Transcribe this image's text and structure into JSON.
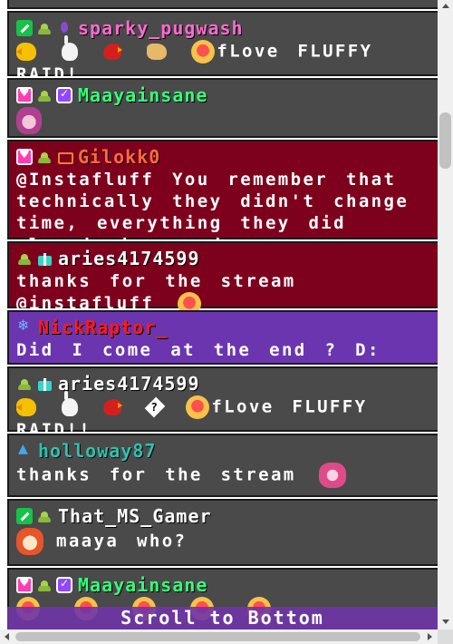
{
  "scroll_banner": "Scroll to Bottom",
  "messages": [
    {
      "user": "sparky_pugwash",
      "user_color": "#ff69d2",
      "badges": [
        "moderator-icon",
        "poo-badge-icon",
        "drop-badge-icon"
      ],
      "emotes": [
        "chick-emote-icon",
        "bunny-emote-icon",
        "bird-emote-icon",
        "dog-emote-icon",
        "fluff-emote-icon"
      ],
      "text": "fLove FLUFFY RAID!"
    },
    {
      "user": "Maayainsane",
      "user_color": "#33ff7a",
      "badges": [
        "heart-badge-icon",
        "poo-badge-icon",
        "prime-badge-icon"
      ],
      "emotes": [
        "girl-emote-icon"
      ],
      "text": ""
    },
    {
      "user": "Gilokk0",
      "user_color": "#ff6a3c",
      "badges": [
        "heart-badge-icon",
        "poo-badge-icon",
        "sub-badge-icon"
      ],
      "text": "@Instafluff You remember that technically they didn't change time, everything they did already happened"
    },
    {
      "user": "aries4174599",
      "user_color": "#ffffff",
      "badges": [
        "poo-badge-icon",
        "gift-badge-icon"
      ],
      "text": "thanks for the stream @instafluff",
      "emotes": [
        "fluff-emote-icon"
      ]
    },
    {
      "user": "NickRaptor_",
      "user_color": "#ff1a1a",
      "badges": [
        "snowflake-badge-icon"
      ],
      "text": "Did I come at the end ? D:"
    },
    {
      "user": "aries4174599",
      "user_color": "#ffffff",
      "badges": [
        "poo-badge-icon",
        "gift-badge-icon"
      ],
      "emotes": [
        "chick-emote-icon",
        "bunny-emote-icon",
        "bird-emote-icon",
        "unknown-glyph-icon",
        "fluff-emote-icon"
      ],
      "text": "fLove FLUFFY RAID!!"
    },
    {
      "user": "holloway87",
      "user_color": "#2ec2b0",
      "badges": [
        "bits-badge-icon"
      ],
      "text": "thanks for the stream",
      "emotes": [
        "pink-emote-icon"
      ]
    },
    {
      "user": "That_MS_Gamer",
      "user_color": "#ffffff",
      "badges": [
        "moderator-icon",
        "poo-badge-icon"
      ],
      "emotes": [
        "face-emote-icon"
      ],
      "text": "maaya who?"
    },
    {
      "user": "Maayainsane",
      "user_color": "#33ff7a",
      "badges": [
        "heart-badge-icon",
        "poo-badge-icon",
        "prime-badge-icon"
      ],
      "emotes": [
        "fluff-emote-icon",
        "fluff-emote-icon",
        "fluff-emote-icon",
        "fluff-emote-icon",
        "fluff-emote-icon"
      ],
      "text": ""
    }
  ],
  "colors": {
    "message_bg": "#4a4a4a",
    "highlight_bg": "#7d001d",
    "purple_bg": "#6b35b0"
  }
}
